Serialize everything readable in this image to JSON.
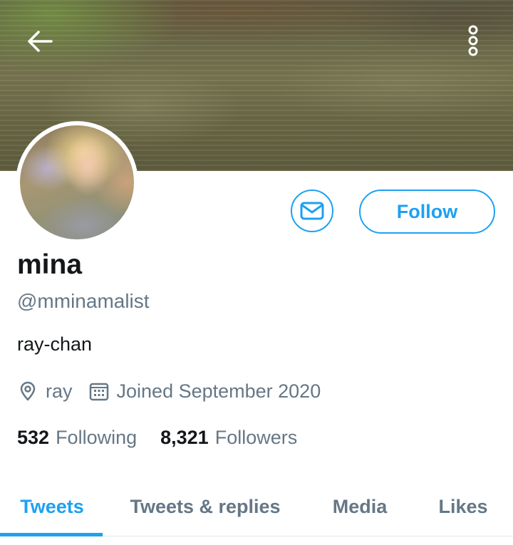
{
  "header": {
    "back_icon": "arrow-left-icon",
    "more_icon": "more-vertical-icon"
  },
  "profile": {
    "display_name": "mina",
    "handle": "@mminamalist",
    "bio": "ray-chan",
    "location": "ray",
    "joined": "Joined September 2020",
    "follow_label": "Follow",
    "message_icon": "mail-icon",
    "location_icon": "location-pin-icon",
    "calendar_icon": "calendar-icon"
  },
  "stats": {
    "following_count": "532",
    "following_label": "Following",
    "followers_count": "8,321",
    "followers_label": "Followers"
  },
  "tabs": [
    {
      "label": "Tweets",
      "active": true
    },
    {
      "label": "Tweets & replies",
      "active": false
    },
    {
      "label": "Media",
      "active": false
    },
    {
      "label": "Likes",
      "active": false
    }
  ],
  "colors": {
    "accent": "#1da1f2",
    "text_primary": "#14171a",
    "text_secondary": "#657786",
    "divider": "#e1e8ed"
  }
}
